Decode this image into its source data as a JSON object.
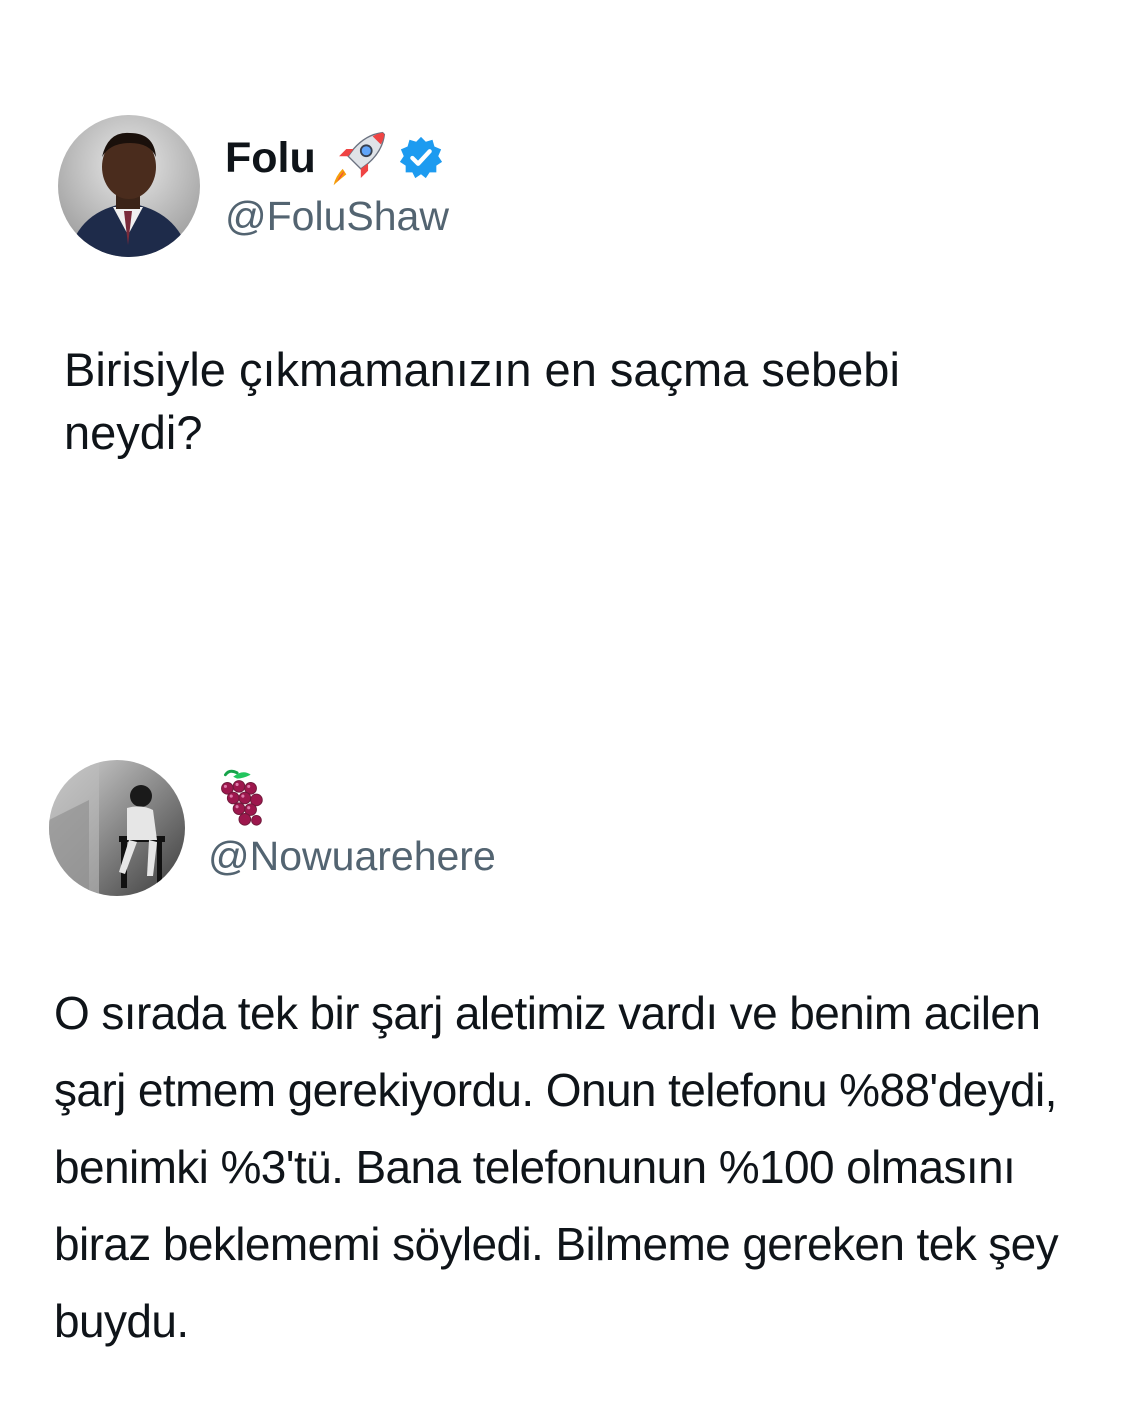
{
  "tweets": [
    {
      "author": {
        "display_name": "Folu",
        "handle": "@FoluShaw",
        "name_emoji": "rocket-icon",
        "verified": true
      },
      "text": "Birisiyle çıkmamanızın en saçma sebebi neydi?"
    },
    {
      "author": {
        "display_name_emoji": "grapes-icon",
        "handle": "@Nowuarehere",
        "verified": false
      },
      "text": "O sırada tek bir şarj aletimiz vardı ve benim acilen şarj etmem gerekiyordu. Onun telefonu %88'deydi, benimki %3'tü. Bana telefonunun %100 olmasını biraz beklememi söyledi. Bilmeme gereken tek şey buydu."
    }
  ],
  "colors": {
    "text": "#0f1419",
    "secondary_text": "#536471",
    "verified_blue": "#1d9bf0",
    "background": "#ffffff"
  }
}
